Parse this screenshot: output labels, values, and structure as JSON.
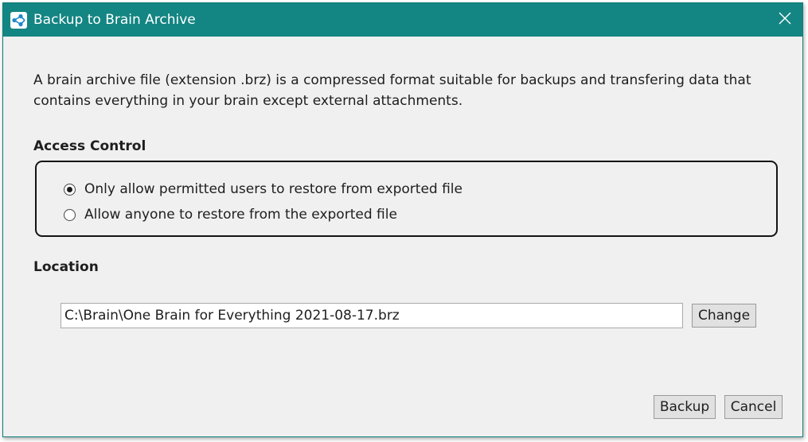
{
  "window": {
    "title": "Backup to Brain Archive",
    "close_symbol": "✕"
  },
  "description": "A brain archive file (extension .brz) is a compressed format suitable for backups and transfering data that contains everything in your brain except external attachments.",
  "access_control": {
    "heading": "Access Control",
    "options": [
      {
        "label": "Only allow permitted users to restore from exported file",
        "selected": true
      },
      {
        "label": "Allow anyone to restore from the exported file",
        "selected": false
      }
    ]
  },
  "location": {
    "heading": "Location",
    "path": "C:\\Brain\\One Brain for Everything 2021-08-17.brz",
    "change_label": "Change"
  },
  "buttons": {
    "backup_label": "Backup",
    "cancel_label": "Cancel"
  },
  "colors": {
    "titlebar": "#138582",
    "window_bg": "#f0f0f0",
    "brain_icon": "#1e88c8"
  },
  "icons": {
    "app": "brain-logo-icon",
    "close": "close-icon"
  }
}
